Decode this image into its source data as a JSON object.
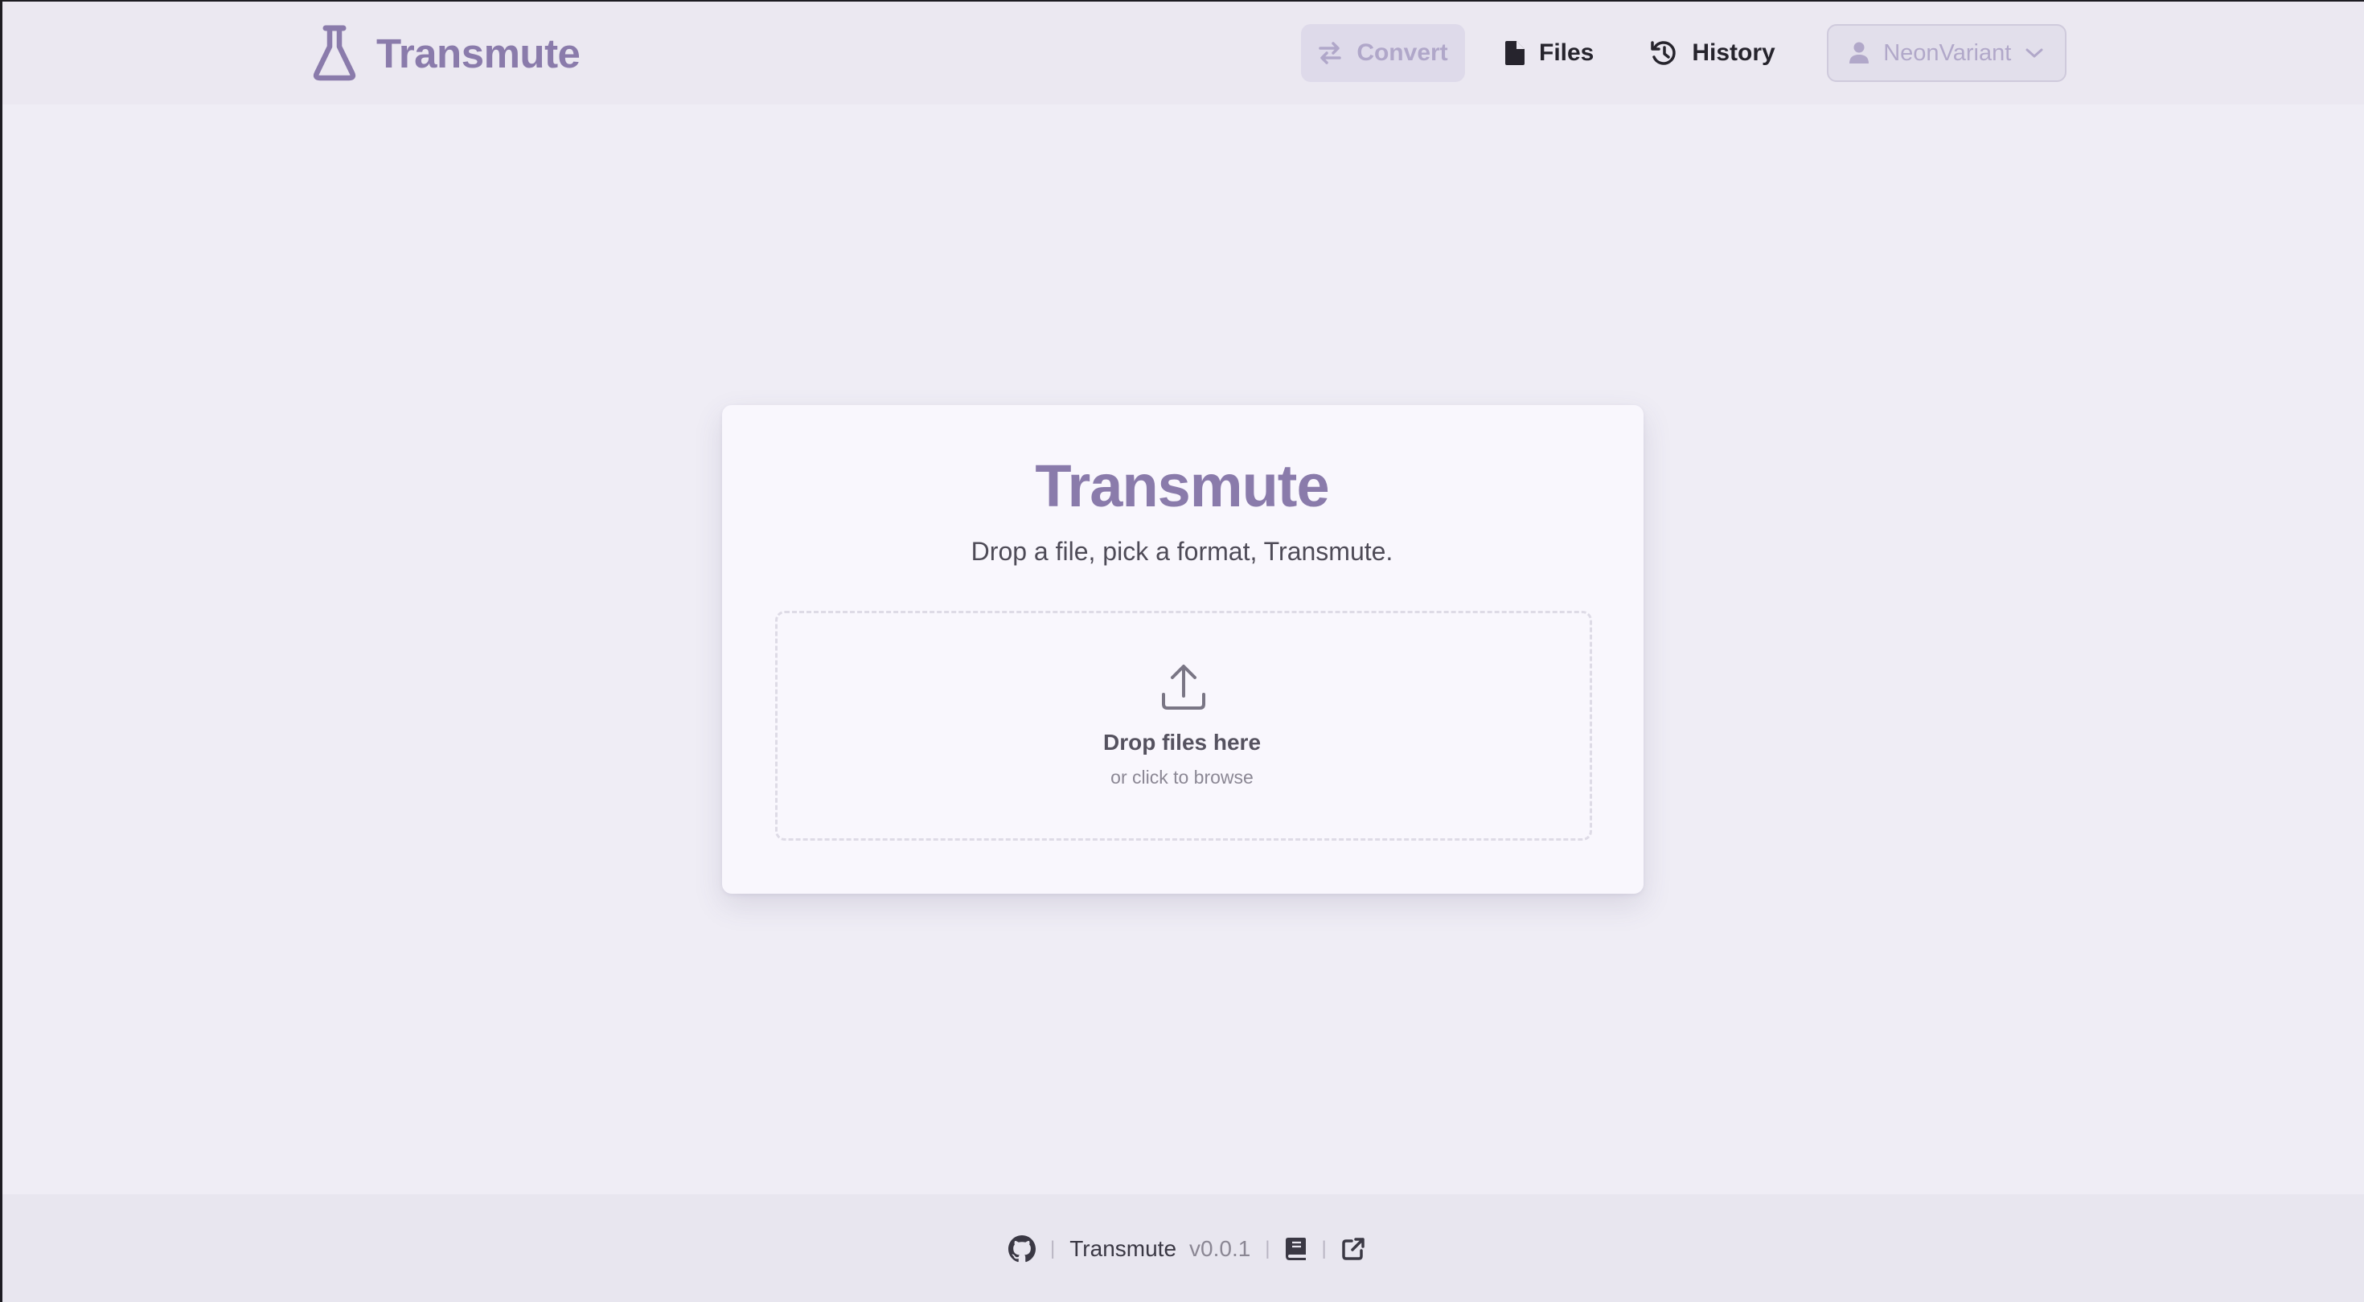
{
  "header": {
    "brand_name": "Transmute",
    "nav": {
      "convert_label": "Convert",
      "files_label": "Files",
      "history_label": "History",
      "user_label": "NeonVariant"
    }
  },
  "main": {
    "title": "Transmute",
    "subtitle": "Drop a file, pick a format, Transmute.",
    "dropzone": {
      "title": "Drop files here",
      "subtitle": "or click to browse"
    }
  },
  "footer": {
    "app_name": "Transmute",
    "version": "v0.0.1",
    "separator": "|"
  },
  "icons": {
    "brand": "flask-icon",
    "convert": "swap-arrows-icon",
    "files": "file-icon",
    "history": "history-icon",
    "user": "user-icon",
    "dropdown": "chevron-down-icon",
    "upload": "upload-icon",
    "github": "github-icon",
    "docs": "book-icon",
    "external": "external-link-icon"
  },
  "colors": {
    "accent": "#8a7bab",
    "background": "#efedf5",
    "card": "#f9f7fd",
    "text": "#26242d"
  }
}
